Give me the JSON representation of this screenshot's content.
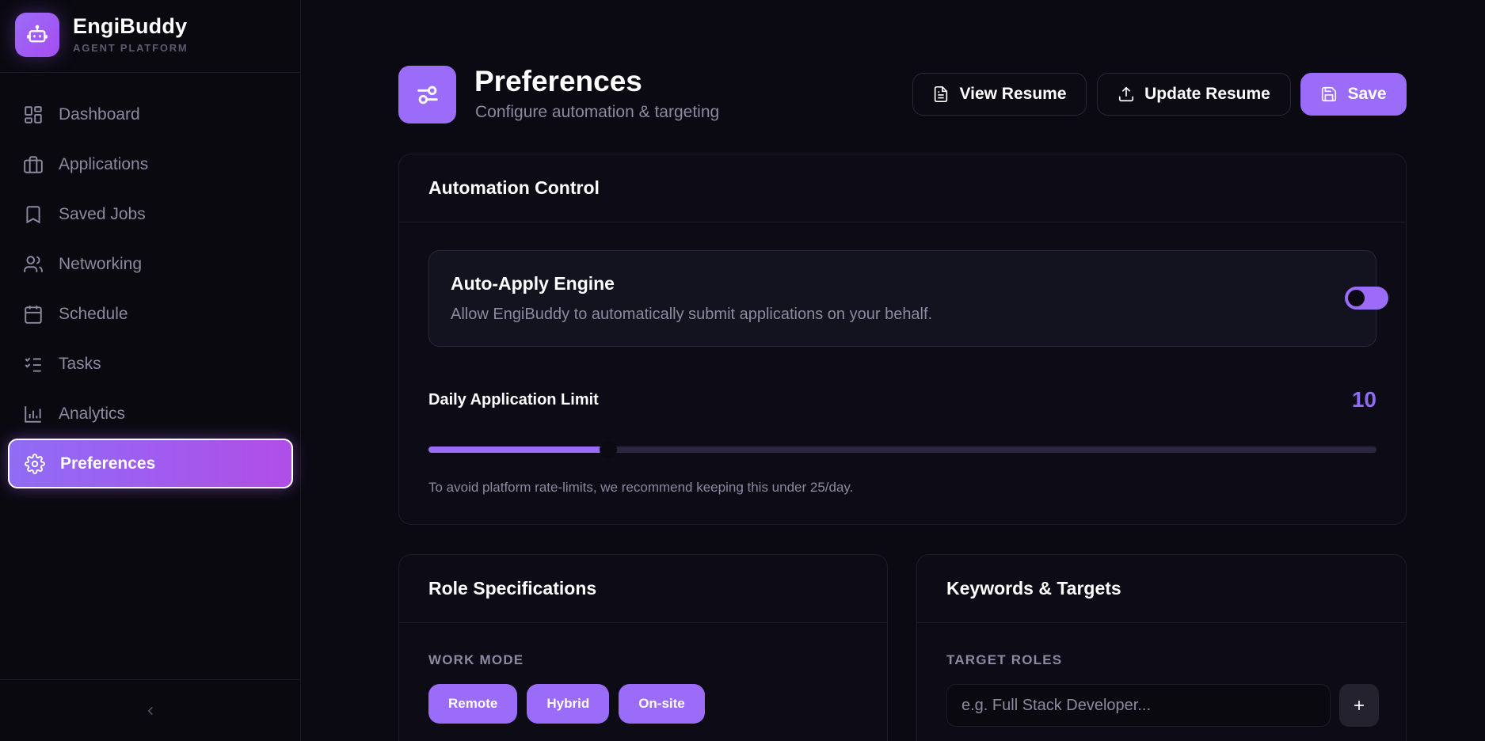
{
  "brand": {
    "name": "EngiBuddy",
    "subtitle": "AGENT PLATFORM"
  },
  "sidebar": {
    "items": [
      {
        "label": "Dashboard",
        "icon": "dashboard-icon"
      },
      {
        "label": "Applications",
        "icon": "briefcase-icon"
      },
      {
        "label": "Saved Jobs",
        "icon": "bookmark-icon"
      },
      {
        "label": "Networking",
        "icon": "users-icon"
      },
      {
        "label": "Schedule",
        "icon": "calendar-icon"
      },
      {
        "label": "Tasks",
        "icon": "tasks-icon"
      },
      {
        "label": "Analytics",
        "icon": "chart-icon"
      },
      {
        "label": "Preferences",
        "icon": "gear-icon",
        "active": true
      }
    ],
    "collapse_icon": "chevron-left-icon"
  },
  "header": {
    "title": "Preferences",
    "subtitle": "Configure automation & targeting",
    "buttons": {
      "view_resume": "View Resume",
      "update_resume": "Update Resume",
      "save": "Save"
    }
  },
  "automation": {
    "title": "Automation Control",
    "engine_title": "Auto-Apply Engine",
    "engine_desc": "Allow EngiBuddy to automatically submit applications on your behalf.",
    "engine_enabled": true,
    "limit_label": "Daily Application Limit",
    "limit_value": "10",
    "limit_fraction": 0.19,
    "hint": "To avoid platform rate-limits, we recommend keeping this under 25/day."
  },
  "role": {
    "title": "Role Specifications",
    "work_mode_label": "WORK MODE",
    "work_modes": [
      "Remote",
      "Hybrid",
      "On-site"
    ]
  },
  "keywords": {
    "title": "Keywords & Targets",
    "target_roles_label": "TARGET ROLES",
    "input_value": "",
    "input_placeholder": "e.g. Full Stack Developer..."
  },
  "colors": {
    "accent": "#9b6cf7",
    "accent_pink": "#b04ee8",
    "background": "#0b0a13",
    "muted_text": "#8c89a0"
  }
}
